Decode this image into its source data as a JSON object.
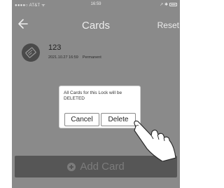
{
  "status_bar": {
    "carrier": "●●●●○ AT&T ᯤ",
    "time": "16:59",
    "indicators": "↗ ✱"
  },
  "nav": {
    "title": "Cards",
    "back_icon": "back-arrow-icon",
    "reset_label": "Reset"
  },
  "card": {
    "name": "123",
    "datetime": "2021.10.27 16:59",
    "validity": "Permanent",
    "icon": "card-icon"
  },
  "dialog": {
    "message": "All Cards for this Lock will be DELETED",
    "cancel_label": "Cancel",
    "delete_label": "Delete"
  },
  "add_button": {
    "label": "Add Card",
    "icon": "plus-circle-icon"
  },
  "colors": {
    "overlay_background": "#8a8a8a",
    "add_button_background": "#565656",
    "dialog_background": "#ffffff"
  }
}
